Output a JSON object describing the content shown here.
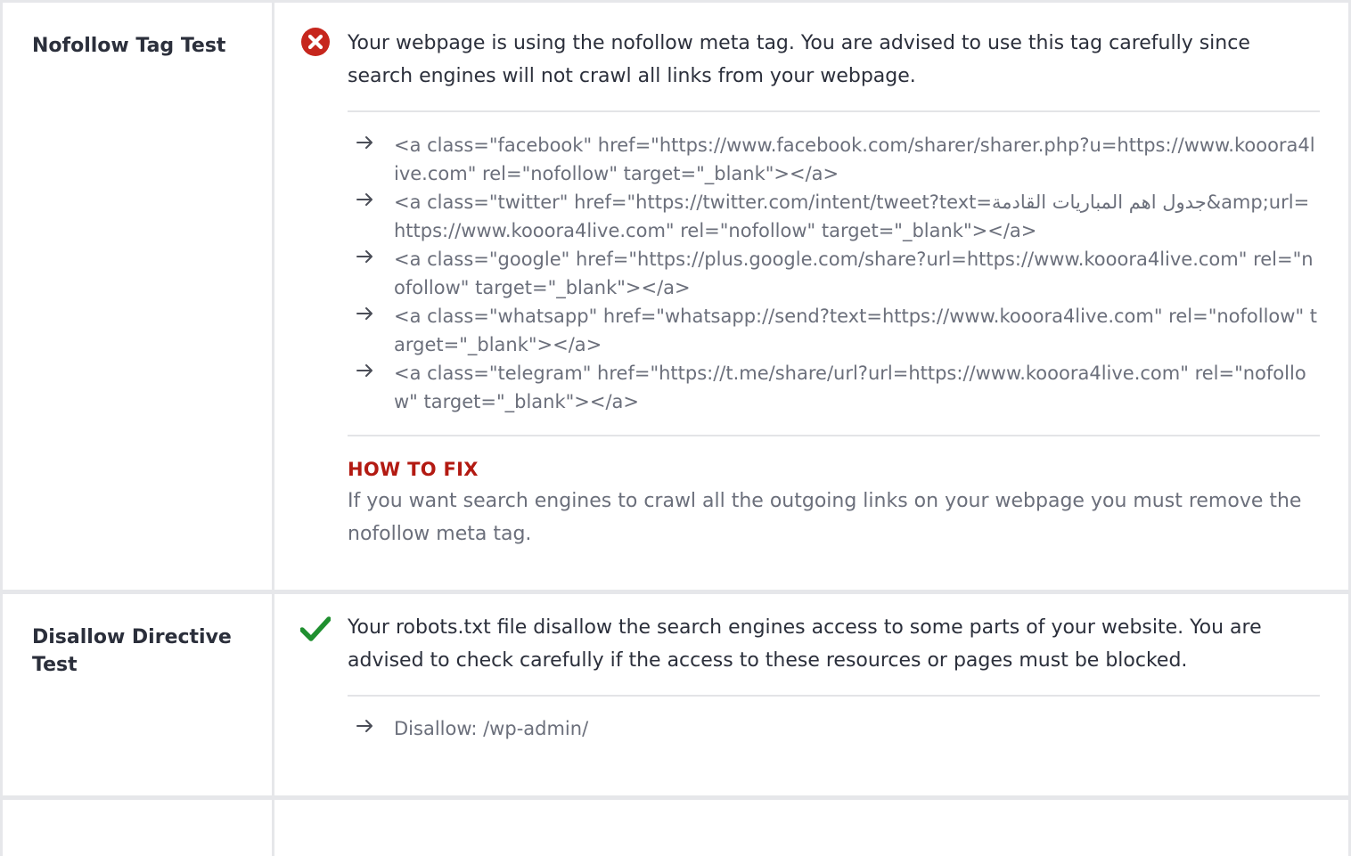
{
  "tests": [
    {
      "title": "Nofollow Tag Test",
      "status": "fail",
      "status_icon": "error-circle-icon",
      "status_color": "#c6261d",
      "message": "Your webpage is using the nofollow meta tag. You are advised to use this tag carefully since search engines will not crawl all links from your webpage.",
      "items": [
        "<a class=\"facebook\" href=\"https://www.facebook.com/sharer/sharer.php?u=https://www.kooora4live.com\" rel=\"nofollow\" target=\"_blank\"></a>",
        "<a class=\"twitter\" href=\"https://twitter.com/intent/tweet?text=جدول اهم المباريات القادمة&amp;url=https://www.kooora4live.com\" rel=\"nofollow\" target=\"_blank\"></a>",
        "<a class=\"google\" href=\"https://plus.google.com/share?url=https://www.kooora4live.com\" rel=\"nofollow\" target=\"_blank\"></a>",
        "<a class=\"whatsapp\" href=\"whatsapp://send?text=https://www.kooora4live.com\" rel=\"nofollow\" target=\"_blank\"></a>",
        "<a class=\"telegram\" href=\"https://t.me/share/url?url=https://www.kooora4live.com\" rel=\"nofollow\" target=\"_blank\"></a>"
      ],
      "how_to_fix_title": "HOW TO FIX",
      "how_to_fix_text": "If you want search engines to crawl all the outgoing links on your webpage you must remove the nofollow meta tag."
    },
    {
      "title": "Disallow Directive Test",
      "status": "pass",
      "status_icon": "check-icon",
      "status_color": "#1f8f2f",
      "message": "Your robots.txt file disallow the search engines access to some parts of your website. You are advised to check carefully if the access to these resources or pages must be blocked.",
      "items": [
        "Disallow: /wp-admin/"
      ]
    }
  ],
  "colors": {
    "border": "#e6e7ea",
    "text": "#2b2f3b",
    "muted_text": "#6b6f7b",
    "fix_title": "#b31a12"
  }
}
